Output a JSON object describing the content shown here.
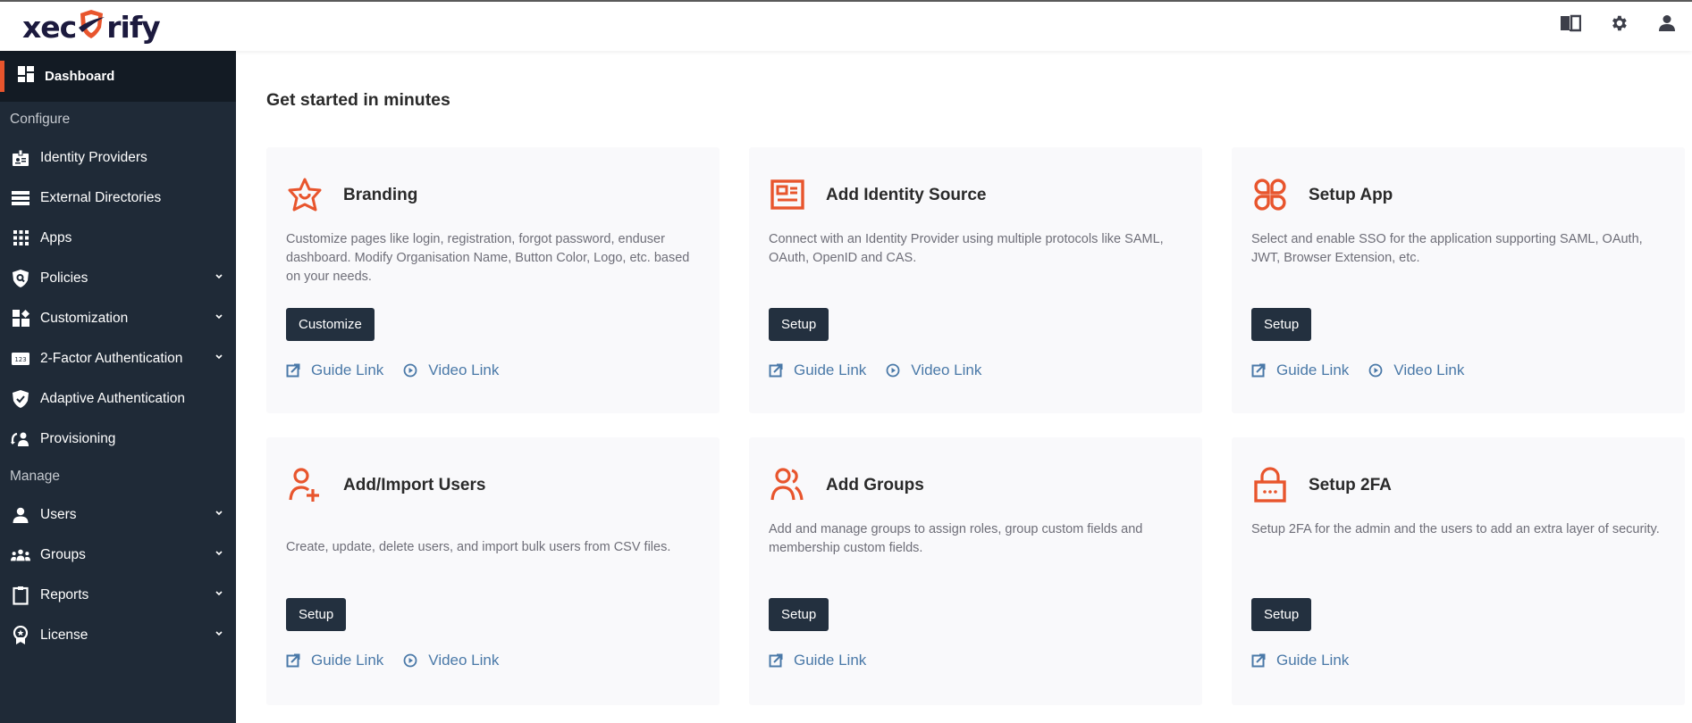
{
  "brand": {
    "logo_pre": "xec",
    "logo_post": "rify",
    "accent": "#e8552d",
    "dark": "#1f2a37"
  },
  "header": {
    "icons": [
      "book-icon",
      "gear-icon",
      "user-icon"
    ]
  },
  "sidebar": {
    "active": {
      "label": "Dashboard",
      "icon": "dashboard-icon"
    },
    "sections": [
      {
        "title": "Configure",
        "items": [
          {
            "label": "Identity Providers",
            "icon": "id-badge-icon",
            "chevron": false
          },
          {
            "label": "External Directories",
            "icon": "server-list-icon",
            "chevron": false
          },
          {
            "label": "Apps",
            "icon": "grid-icon",
            "chevron": false
          },
          {
            "label": "Policies",
            "icon": "shield-search-icon",
            "chevron": true
          },
          {
            "label": "Customization",
            "icon": "widgets-icon",
            "chevron": true
          },
          {
            "label": "2-Factor Authentication",
            "icon": "pin-123-icon",
            "chevron": true
          },
          {
            "label": "Adaptive Authentication",
            "icon": "shield-check-icon",
            "chevron": false
          },
          {
            "label": "Provisioning",
            "icon": "sync-user-icon",
            "chevron": false
          }
        ]
      },
      {
        "title": "Manage",
        "items": [
          {
            "label": "Users",
            "icon": "user-icon",
            "chevron": true
          },
          {
            "label": "Groups",
            "icon": "groups-icon",
            "chevron": true
          },
          {
            "label": "Reports",
            "icon": "clipboard-icon",
            "chevron": true
          },
          {
            "label": "License",
            "icon": "award-icon",
            "chevron": true
          }
        ]
      }
    ]
  },
  "main": {
    "title": "Get started in minutes",
    "cards": [
      {
        "title": "Branding",
        "icon": "star-icon",
        "description": "Customize pages like login, registration, forgot password, enduser dashboard. Modify Organisation Name, Button Color, Logo, etc. based on your needs.",
        "button": "Customize",
        "guide_link": "Guide Link",
        "video_link": "Video Link"
      },
      {
        "title": "Add Identity Source",
        "icon": "id-card-icon",
        "description": "Connect with an Identity Provider using multiple protocols like SAML, OAuth, OpenID and CAS.",
        "button": "Setup",
        "guide_link": "Guide Link",
        "video_link": "Video Link"
      },
      {
        "title": "Setup App",
        "icon": "apps-icon",
        "description": "Select and enable SSO for the application supporting SAML, OAuth, JWT, Browser Extension, etc.",
        "button": "Setup",
        "guide_link": "Guide Link",
        "video_link": "Video Link"
      },
      {
        "title": "Add/Import Users",
        "icon": "user-plus-icon",
        "description": "Create, update, delete users, and import bulk users from CSV files.",
        "button": "Setup",
        "guide_link": "Guide Link",
        "video_link": "Video Link"
      },
      {
        "title": "Add Groups",
        "icon": "users-icon",
        "description": "Add and manage groups to assign roles, group custom fields and membership custom fields.",
        "button": "Setup",
        "guide_link": "Guide Link",
        "video_link": null
      },
      {
        "title": "Setup 2FA",
        "icon": "lock-icon",
        "description": "Setup 2FA for the admin and the users to add an extra layer of security.",
        "button": "Setup",
        "guide_link": "Guide Link",
        "video_link": null
      }
    ]
  }
}
